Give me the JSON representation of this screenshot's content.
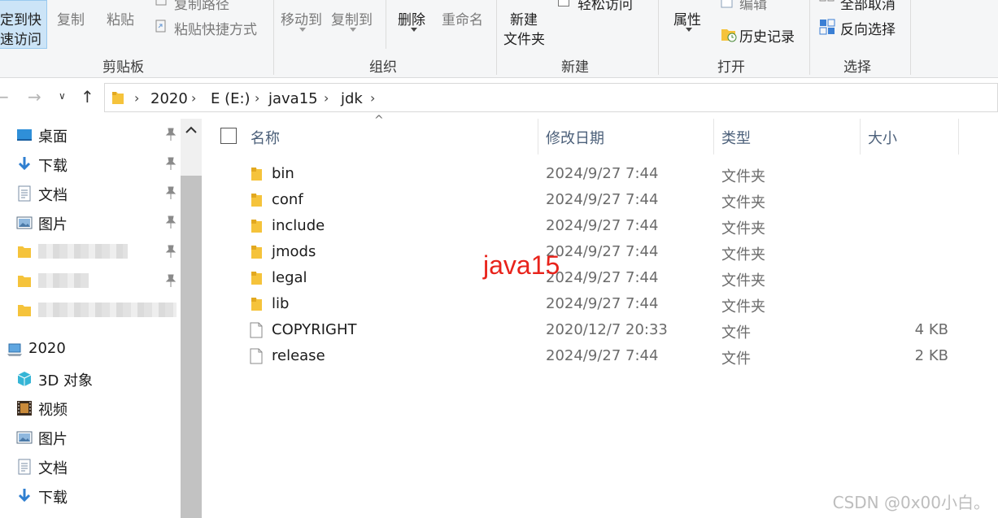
{
  "ribbon": {
    "clipboard": {
      "pin_quick_access": [
        "定到快",
        "速访问"
      ],
      "copy": "复制",
      "paste": "粘贴",
      "copy_path": "复制路径",
      "paste_shortcut": "粘贴快捷方式",
      "group_label": "剪贴板"
    },
    "organize": {
      "move_to": "移动到",
      "copy_to": "复制到",
      "delete": "删除",
      "rename": "重命名",
      "group_label": "组织"
    },
    "new": {
      "new_folder": [
        "新建",
        "文件夹"
      ],
      "easy_access": "轻松访问",
      "group_label": "新建"
    },
    "open": {
      "properties": "属性",
      "edit": "编辑",
      "history": "历史记录",
      "group_label": "打开"
    },
    "select": {
      "select_none": "全部取消",
      "invert_selection": "反向选择",
      "group_label": "选择"
    }
  },
  "address": {
    "crumbs": [
      "2020",
      "E (E:)",
      "java15",
      "jdk"
    ]
  },
  "sidebar": {
    "pinned": [
      {
        "label": "桌面",
        "icon": "desktop-icon"
      },
      {
        "label": "下载",
        "icon": "download-icon"
      },
      {
        "label": "文档",
        "icon": "document-icon"
      },
      {
        "label": "图片",
        "icon": "pictures-icon"
      }
    ],
    "this_pc": "2020",
    "pc_items": [
      {
        "label": "3D 对象",
        "icon": "3d-objects-icon"
      },
      {
        "label": "视频",
        "icon": "video-icon"
      },
      {
        "label": "图片",
        "icon": "pictures-icon"
      },
      {
        "label": "文档",
        "icon": "document-icon"
      },
      {
        "label": "下载",
        "icon": "download-icon"
      }
    ]
  },
  "columns": {
    "name": "名称",
    "date": "修改日期",
    "type": "类型",
    "size": "大小"
  },
  "files": [
    {
      "name": "bin",
      "date": "2024/9/27 7:44",
      "type": "文件夹",
      "size": "",
      "kind": "folder"
    },
    {
      "name": "conf",
      "date": "2024/9/27 7:44",
      "type": "文件夹",
      "size": "",
      "kind": "folder"
    },
    {
      "name": "include",
      "date": "2024/9/27 7:44",
      "type": "文件夹",
      "size": "",
      "kind": "folder"
    },
    {
      "name": "jmods",
      "date": "2024/9/27 7:44",
      "type": "文件夹",
      "size": "",
      "kind": "folder"
    },
    {
      "name": "legal",
      "date": "2024/9/27 7:44",
      "type": "文件夹",
      "size": "",
      "kind": "folder"
    },
    {
      "name": "lib",
      "date": "2024/9/27 7:44",
      "type": "文件夹",
      "size": "",
      "kind": "folder"
    },
    {
      "name": "COPYRIGHT",
      "date": "2020/12/7 20:33",
      "type": "文件",
      "size": "4 KB",
      "kind": "file"
    },
    {
      "name": "release",
      "date": "2024/9/27 7:44",
      "type": "文件",
      "size": "2 KB",
      "kind": "file"
    }
  ],
  "annotation": "java15",
  "watermark": "CSDN @0x00小白。",
  "colors": {
    "folder": "#f5c33b",
    "selected_button": "#cce4f7",
    "annotation": "#e8231b",
    "column_header": "#4c607a"
  }
}
